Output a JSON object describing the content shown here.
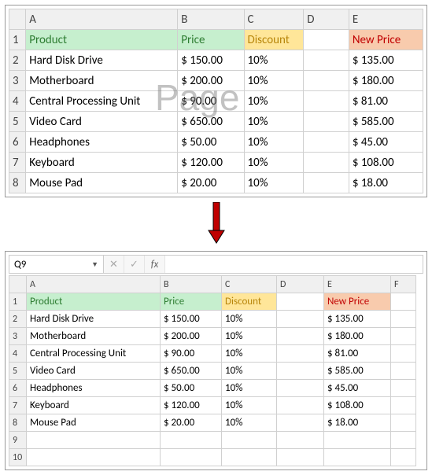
{
  "watermark": "Page",
  "cols": [
    "A",
    "B",
    "C",
    "D",
    "E",
    "F"
  ],
  "headers": {
    "product": "Product",
    "price": "Price",
    "discount": "Discount",
    "newprice": "New Price"
  },
  "rows": [
    {
      "n": "1"
    },
    {
      "n": "2"
    },
    {
      "n": "3"
    },
    {
      "n": "4"
    },
    {
      "n": "5"
    },
    {
      "n": "6"
    },
    {
      "n": "7"
    },
    {
      "n": "8"
    },
    {
      "n": "9"
    },
    {
      "n": "10"
    }
  ],
  "data": [
    {
      "product": "Hard Disk Drive",
      "price": "$ 150.00",
      "discount": "10%",
      "newprice": "$  135.00"
    },
    {
      "product": "Motherboard",
      "price": "$ 200.00",
      "discount": "10%",
      "newprice": "$  180.00"
    },
    {
      "product": "Central Processing Unit",
      "price": "$   90.00",
      "discount": "10%",
      "newprice": "$    81.00"
    },
    {
      "product": "Video Card",
      "price": "$ 650.00",
      "discount": "10%",
      "newprice": "$  585.00"
    },
    {
      "product": "Headphones",
      "price": "$   50.00",
      "discount": "10%",
      "newprice": "$    45.00"
    },
    {
      "product": "Keyboard",
      "price": "$ 120.00",
      "discount": "10%",
      "newprice": "$  108.00"
    },
    {
      "product": "Mouse Pad",
      "price": "$   20.00",
      "discount": "10%",
      "newprice": "$    18.00"
    }
  ],
  "formula_bar": {
    "namebox": "Q9",
    "fx_label": "fx",
    "cancel": "✕",
    "confirm": "✓",
    "value": ""
  },
  "chart_data": {
    "type": "table",
    "columns": [
      "Product",
      "Price",
      "Discount",
      "New Price"
    ],
    "rows": [
      [
        "Hard Disk Drive",
        150.0,
        0.1,
        135.0
      ],
      [
        "Motherboard",
        200.0,
        0.1,
        180.0
      ],
      [
        "Central Processing Unit",
        90.0,
        0.1,
        81.0
      ],
      [
        "Video Card",
        650.0,
        0.1,
        585.0
      ],
      [
        "Headphones",
        50.0,
        0.1,
        45.0
      ],
      [
        "Keyboard",
        120.0,
        0.1,
        108.0
      ],
      [
        "Mouse Pad",
        20.0,
        0.1,
        18.0
      ]
    ]
  }
}
